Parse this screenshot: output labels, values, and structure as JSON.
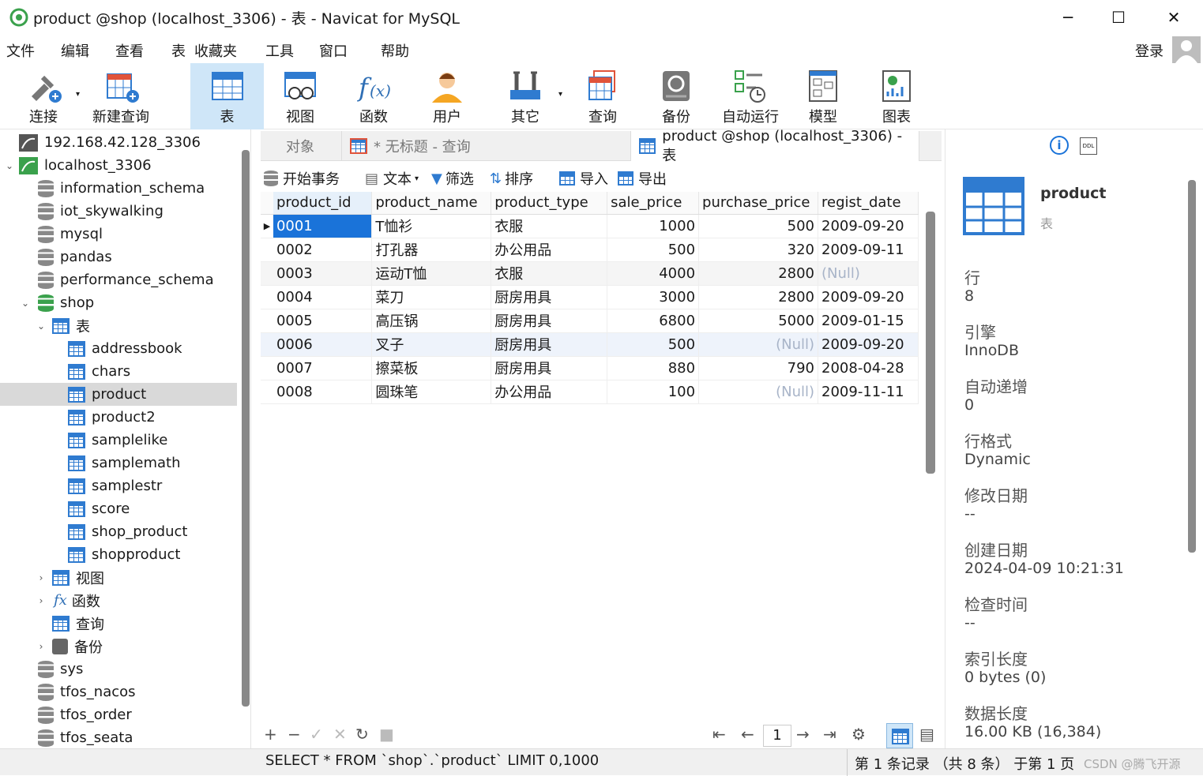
{
  "window": {
    "title": "product @shop (localhost_3306) - 表 - Navicat for MySQL",
    "minimize": "─",
    "maximize": "☐",
    "close": "✕"
  },
  "menu": [
    "文件",
    "编辑",
    "查看",
    "表",
    "收藏夹",
    "工具",
    "窗口",
    "帮助"
  ],
  "login": "登录",
  "toolbar": [
    {
      "label": "连接",
      "icon": "plug-icon"
    },
    {
      "label": "新建查询",
      "icon": "new-query-icon"
    },
    {
      "label": "表",
      "icon": "table-icon"
    },
    {
      "label": "视图",
      "icon": "view-icon"
    },
    {
      "label": "函数",
      "icon": "function-icon"
    },
    {
      "label": "用户",
      "icon": "user-icon"
    },
    {
      "label": "其它",
      "icon": "tools-icon"
    },
    {
      "label": "查询",
      "icon": "query-icon"
    },
    {
      "label": "备份",
      "icon": "backup-icon"
    },
    {
      "label": "自动运行",
      "icon": "autorun-icon"
    },
    {
      "label": "模型",
      "icon": "model-icon"
    },
    {
      "label": "图表",
      "icon": "chart-icon"
    }
  ],
  "sidebar": {
    "connections": [
      {
        "label": "192.168.42.128_3306"
      },
      {
        "label": "localhost_3306"
      }
    ],
    "databases_top": [
      "information_schema",
      "iot_skywalking",
      "mysql",
      "pandas",
      "performance_schema"
    ],
    "shop": "shop",
    "tables_group": "表",
    "tables": [
      "addressbook",
      "chars",
      "product",
      "product2",
      "samplelike",
      "samplemath",
      "samplestr",
      "score",
      "shop_product",
      "shopproduct"
    ],
    "groups": [
      "视图",
      "函数",
      "查询",
      "备份"
    ],
    "databases_bottom": [
      "sys",
      "tfos_nacos",
      "tfos_order",
      "tfos_seata"
    ]
  },
  "tabs": {
    "objects": "对象",
    "untitled": "* 无标题 - 查询",
    "active": "product @shop (localhost_3306) - 表"
  },
  "subbar": {
    "begin_tx": "开始事务",
    "text": "文本",
    "filter": "筛选",
    "sort": "排序",
    "import": "导入",
    "export": "导出"
  },
  "grid": {
    "columns": [
      "product_id",
      "product_name",
      "product_type",
      "sale_price",
      "purchase_price",
      "regist_date"
    ],
    "rows": [
      [
        "0001",
        "T恤衫",
        "衣服",
        "1000",
        "500",
        "2009-09-20"
      ],
      [
        "0002",
        "打孔器",
        "办公用品",
        "500",
        "320",
        "2009-09-11"
      ],
      [
        "0003",
        "运动T恤",
        "衣服",
        "4000",
        "2800",
        "(Null)"
      ],
      [
        "0004",
        "菜刀",
        "厨房用具",
        "3000",
        "2800",
        "2009-09-20"
      ],
      [
        "0005",
        "高压锅",
        "厨房用具",
        "6800",
        "5000",
        "2009-01-15"
      ],
      [
        "0006",
        "叉子",
        "厨房用具",
        "500",
        "(Null)",
        "2009-09-20"
      ],
      [
        "0007",
        "擦菜板",
        "厨房用具",
        "880",
        "790",
        "2008-04-28"
      ],
      [
        "0008",
        "圆珠笔",
        "办公用品",
        "100",
        "(Null)",
        "2009-11-11"
      ]
    ]
  },
  "pager": {
    "page": "1"
  },
  "status": {
    "sql": "SELECT * FROM `shop`.`product` LIMIT 0,1000",
    "record": "第 1 条记录 （共 8 条） 于第 1 页",
    "watermark": "CSDN @腾飞开源"
  },
  "info": {
    "name": "product",
    "type": "表",
    "fields": [
      {
        "label": "行",
        "value": "8"
      },
      {
        "label": "引擎",
        "value": "InnoDB"
      },
      {
        "label": "自动递增",
        "value": "0"
      },
      {
        "label": "行格式",
        "value": "Dynamic"
      },
      {
        "label": "修改日期",
        "value": "--"
      },
      {
        "label": "创建日期",
        "value": "2024-04-09 10:21:31"
      },
      {
        "label": "检查时间",
        "value": "--"
      },
      {
        "label": "索引长度",
        "value": "0 bytes (0)"
      },
      {
        "label": "数据长度",
        "value": "16.00 KB (16,384)"
      }
    ]
  }
}
